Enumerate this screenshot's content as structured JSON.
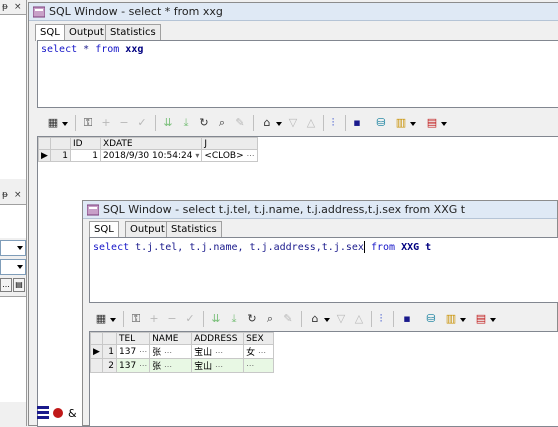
{
  "left_dock": {
    "pin1": "P",
    "close1": "×",
    "pin2": "P",
    "close2": "×",
    "btn_label": "..."
  },
  "window1": {
    "title": "SQL Window - select * from xxg",
    "tabs": [
      "SQL",
      "Output",
      "Statistics"
    ],
    "sql": {
      "kw1": "select",
      "star": " * ",
      "kw2": "from",
      "tbl": " xxg"
    },
    "grid": {
      "columns": [
        "ID",
        "XDATE",
        "J"
      ],
      "rows": [
        {
          "num": "1",
          "id": "1",
          "xdate": "2018/9/30 10:54:24",
          "j": "<CLOB>"
        }
      ]
    }
  },
  "window2": {
    "title": "SQL Window - select t.j.tel, t.j.name, t.j.address,t.j.sex from XXG t",
    "tabs": [
      "SQL",
      "Output",
      "Statistics"
    ],
    "sql": {
      "kw1": "select",
      "cols": " t.j.tel, t.j.name, t.j.address,t.j.sex",
      "kw2": " from",
      "tbl": " XXG t"
    },
    "grid": {
      "columns": [
        "TEL",
        "NAME",
        "ADDRESS",
        "SEX"
      ],
      "rows": [
        {
          "num": "1",
          "tel": "137",
          "name": "张",
          "address": "宝山",
          "sex": "女"
        },
        {
          "num": "2",
          "tel": "137",
          "name": "张",
          "address": "宝山",
          "sex": ""
        }
      ]
    }
  },
  "toolbar_icons": [
    "grid-toggle-icon",
    "lock-icon",
    "add-record-icon",
    "delete-record-icon",
    "post-changes-icon",
    "fetch-next-icon",
    "fetch-last-icon",
    "refresh-icon",
    "find-icon",
    "clear-icon",
    "query-by-example-icon",
    "filter-down-icon",
    "filter-up-icon",
    "chart-icon",
    "save-icon",
    "export-icon",
    "print-icon",
    "table-icon"
  ],
  "colors": {
    "keyword": "#1515c8",
    "identifier": "#000080",
    "alt_row": "#e8f8e4",
    "titlebar": "#dfe9f5"
  }
}
